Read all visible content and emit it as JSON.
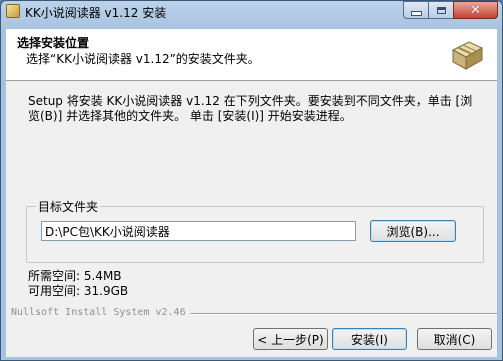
{
  "window": {
    "title": "KK小说阅读器 v1.12 安装"
  },
  "header": {
    "title": "选择安装位置",
    "subtitle": "选择“KK小说阅读器 v1.12”的安装文件夹。"
  },
  "intro": "Setup 将安装 KK小说阅读器 v1.12 在下列文件夹。要安装到不同文件夹，单击 [浏览(B)] 并选择其他的文件夹。 单击 [安装(I)] 开始安装进程。",
  "destination": {
    "label": "目标文件夹",
    "path": "D:\\PC包\\KK小说阅读器",
    "browse_label": "浏览(B)..."
  },
  "space": {
    "required": "所需空间: 5.4MB",
    "available": "可用空间: 31.9GB"
  },
  "brand": "Nullsoft Install System v2.46",
  "buttons": {
    "back": "< 上一步(P)",
    "install": "安装(I)",
    "cancel": "取消(C)"
  },
  "icons": [
    "app-icon",
    "minimize-icon",
    "maximize-icon",
    "close-icon",
    "package-icon"
  ]
}
